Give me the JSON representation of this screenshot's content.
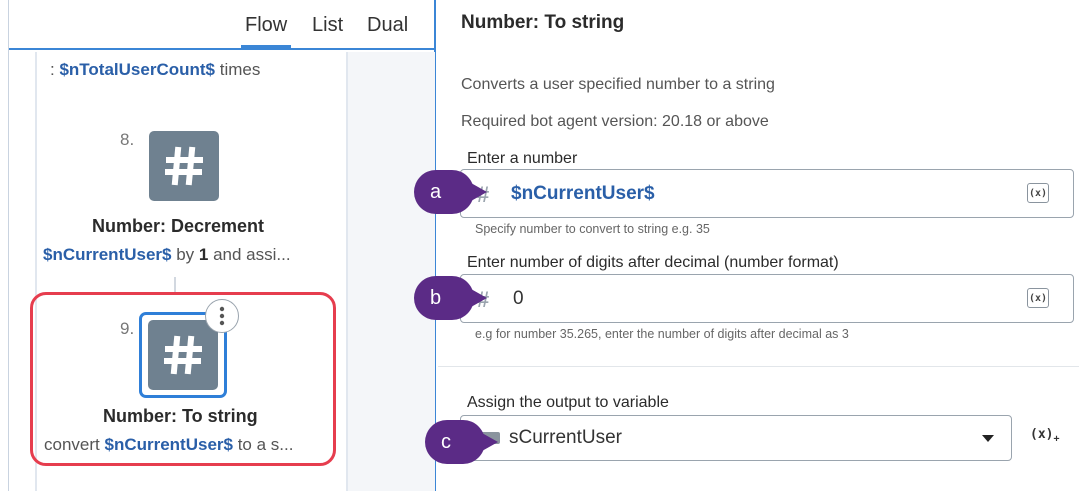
{
  "flow_panel": {
    "tabs": [
      {
        "label": "Flow",
        "active": true
      },
      {
        "label": "List",
        "active": false
      },
      {
        "label": "Dual",
        "active": false
      }
    ],
    "loop_text": {
      "prefix": ": ",
      "variable": "$nTotalUserCount$",
      "suffix": " times"
    },
    "steps": [
      {
        "number": "8.",
        "icon": "hash-icon",
        "title": "Number: Decrement",
        "sub_variable": "$nCurrentUser$",
        "sub_middle": " by ",
        "sub_bold": "1",
        "sub_suffix": " and assi..."
      },
      {
        "number": "9.",
        "icon": "hash-icon",
        "title": "Number: To string",
        "sub_prefix": "convert ",
        "sub_variable": "$nCurrentUser$",
        "sub_suffix": " to a s...",
        "selected": true
      }
    ],
    "colors": {
      "accent": "#3b86d6",
      "selection": "#e63d4e",
      "tile": "#6f8190",
      "variable": "#2a5fa8"
    }
  },
  "properties": {
    "title": "Number: To string",
    "description": "Converts a user specified number to a string",
    "version": "Required bot agent version: 20.18 or above",
    "fields": [
      {
        "label": "Enter a number",
        "value": "$nCurrentUser$",
        "hint": "Specify number to convert to string e.g. 35",
        "var_button": "(x)"
      },
      {
        "label": "Enter number of digits after decimal (number format)",
        "value": "0",
        "hint": "e.g for number 35.265, enter the number of digits after decimal as 3",
        "var_button": "(x)"
      }
    ],
    "output": {
      "label": "Assign the output to variable",
      "value": "sCurrentUser",
      "add_button": "(x)",
      "add_button_sub": "+"
    }
  },
  "callouts": [
    "a",
    "b",
    "c"
  ],
  "callout_color": "#5b2b86"
}
